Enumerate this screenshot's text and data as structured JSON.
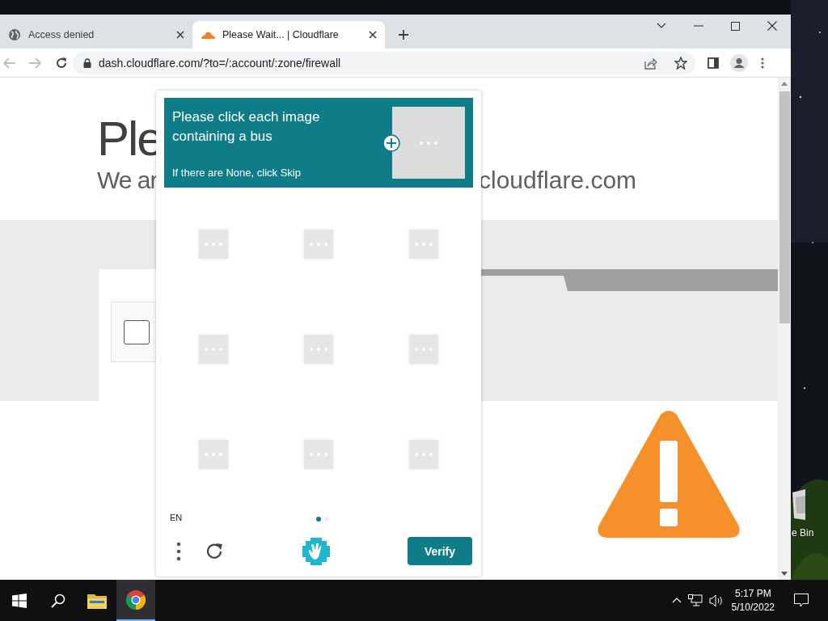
{
  "browser": {
    "tabs": [
      {
        "title": "Access denied",
        "selected": false,
        "kind": "globe"
      },
      {
        "title": "Please Wait... | Cloudflare",
        "selected": true,
        "kind": "cloud"
      }
    ],
    "nav": {
      "back": {
        "disabled": true
      },
      "forward": {
        "disabled": true
      }
    },
    "address_bar": {
      "url": "dash.cloudflare.com/?to=/:account/:zone/firewall"
    }
  },
  "page": {
    "heading": "Ple",
    "subtitle_start": "We ar",
    "subtitle_end": "cloudflare.com",
    "checkbox": {
      "checked": false
    }
  },
  "captcha": {
    "prompt": "Please click each image containing a bus",
    "hint": "If there are None, click Skip",
    "example": {
      "kind": "loading"
    },
    "tiles": [
      {
        "kind": "loading"
      },
      {
        "kind": "loading"
      },
      {
        "kind": "loading"
      },
      {
        "kind": "loading"
      },
      {
        "kind": "loading"
      },
      {
        "kind": "loading"
      },
      {
        "kind": "loading"
      },
      {
        "kind": "loading"
      },
      {
        "kind": "loading"
      }
    ],
    "language": "EN",
    "pages": [
      {
        "selected": true
      },
      {
        "selected": false
      }
    ],
    "verify_button": "Verify"
  },
  "desktop": {
    "icon_label": "e Bin"
  },
  "taskbar": {
    "apps": [
      {
        "kind": "explorer",
        "active": false
      },
      {
        "kind": "chrome",
        "active": true
      }
    ],
    "time": "5:17 PM",
    "date": "5/10/2022"
  }
}
